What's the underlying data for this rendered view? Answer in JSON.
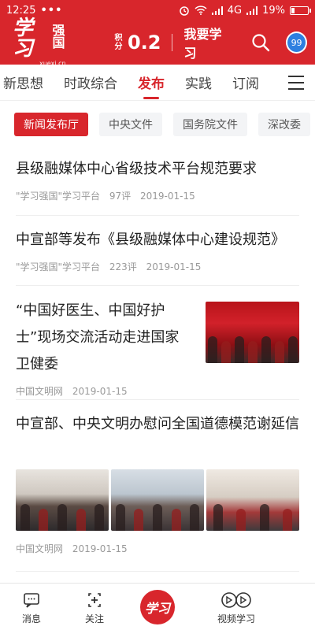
{
  "status_bar": {
    "time": "12:25",
    "dots": "•••",
    "network": "4G",
    "battery": "19%"
  },
  "header": {
    "logo_script": "学习",
    "logo_text": "强国",
    "logo_sub": "xuexi.cn",
    "points_label": "积分",
    "points_value": "0.2",
    "study_label": "我要学习",
    "badge_count": "99"
  },
  "tabs": [
    "新思想",
    "时政综合",
    "发布",
    "实践",
    "订阅"
  ],
  "subtabs": [
    "新闻发布厅",
    "中央文件",
    "国务院文件",
    "深改委"
  ],
  "articles": [
    {
      "title": "县级融媒体中心省级技术平台规范要求",
      "source": "\"学习强国\"学习平台",
      "comments": "97评",
      "date": "2019-01-15"
    },
    {
      "title": "中宣部等发布《县级融媒体中心建设规范》",
      "source": "\"学习强国\"学习平台",
      "comments": "223评",
      "date": "2019-01-15"
    },
    {
      "title": "“中国好医生、中国好护士”现场交流活动走进国家卫健委",
      "source": "中国文明网",
      "date": "2019-01-15"
    },
    {
      "title": "中宣部、中央文明办慰问全国道德模范谢延信",
      "source": "中国文明网",
      "date": "2019-01-15"
    }
  ],
  "bottom_nav": {
    "messages": "消息",
    "follow": "关注",
    "center": "学习",
    "video": "视频学习"
  },
  "colors": {
    "brand_red": "#d8262c",
    "badge_blue": "#2e7fe0"
  }
}
